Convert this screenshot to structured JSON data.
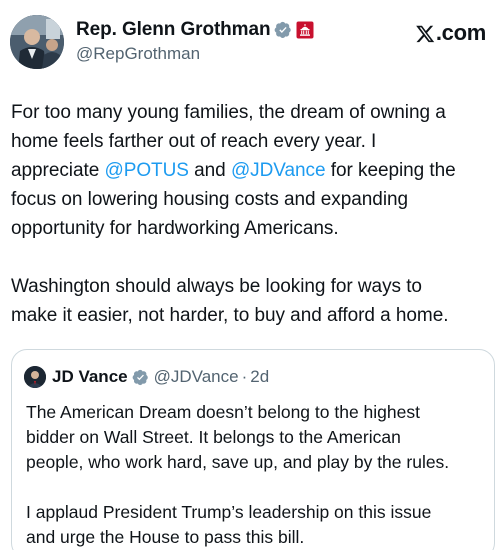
{
  "tweet": {
    "author_name": "Rep. Glenn Grothman",
    "author_handle": "@RepGrothman",
    "brand": ".com",
    "lines": [
      {
        "segments": [
          {
            "text": "For too many young families, the dream of owning a",
            "mention": false
          }
        ]
      },
      {
        "segments": [
          {
            "text": "home feels farther out of reach every year. I",
            "mention": false
          }
        ]
      },
      {
        "segments": [
          {
            "text": "appreciate ",
            "mention": false
          },
          {
            "text": "@POTUS",
            "mention": true
          },
          {
            "text": " and ",
            "mention": false
          },
          {
            "text": "@JDVance",
            "mention": true
          },
          {
            "text": " for keeping the",
            "mention": false
          }
        ]
      },
      {
        "segments": [
          {
            "text": "focus on lowering housing costs and expanding",
            "mention": false
          }
        ]
      },
      {
        "segments": [
          {
            "text": "opportunity for hardworking Americans.",
            "mention": false
          }
        ]
      },
      {
        "segments": []
      },
      {
        "segments": [
          {
            "text": "Washington should always be looking for ways to",
            "mention": false
          }
        ]
      },
      {
        "segments": [
          {
            "text": "make it easier, not harder, to buy and afford a home.",
            "mention": false
          }
        ]
      }
    ]
  },
  "quote": {
    "author_name": "JD Vance",
    "author_handle": "@JDVance",
    "separator": "·",
    "time": "2d",
    "lines": [
      "The American Dream doesn’t belong to the highest",
      "bidder on Wall Street. It belongs to the American",
      "people, who work hard, save up, and play by the rules.",
      "",
      "I applaud President Trump’s leadership on this issue",
      "and urge the House to pass this bill."
    ]
  },
  "colors": {
    "mention": "#1d9bf0",
    "verified": "#829aab",
    "secondary_text": "#536471",
    "border": "#cfd9de",
    "affiliation_badge": "#c8102e"
  },
  "icons": [
    "verified-badge-icon",
    "congress-affiliation-icon",
    "x-logo-icon"
  ]
}
